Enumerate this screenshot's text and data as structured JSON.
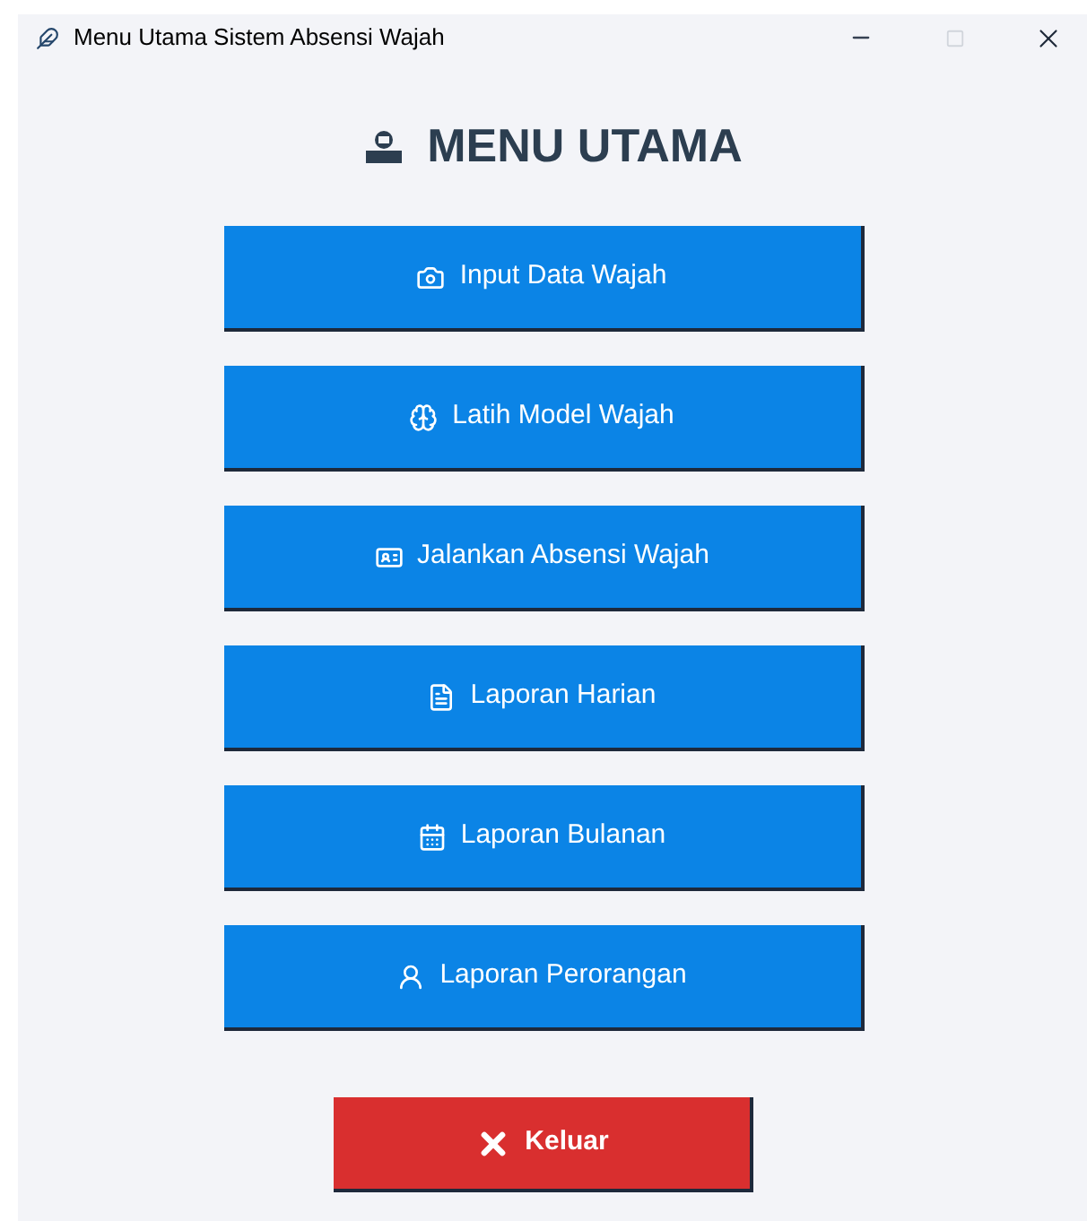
{
  "window": {
    "title": "Menu Utama Sistem Absensi Wajah"
  },
  "heading": "MENU UTAMA",
  "menu": [
    {
      "label": "Input Data Wajah"
    },
    {
      "label": "Latih Model Wajah"
    },
    {
      "label": "Jalankan Absensi Wajah"
    },
    {
      "label": "Laporan Harian"
    },
    {
      "label": "Laporan Bulanan"
    },
    {
      "label": "Laporan Perorangan"
    }
  ],
  "exit_button": {
    "label": "Keluar"
  }
}
